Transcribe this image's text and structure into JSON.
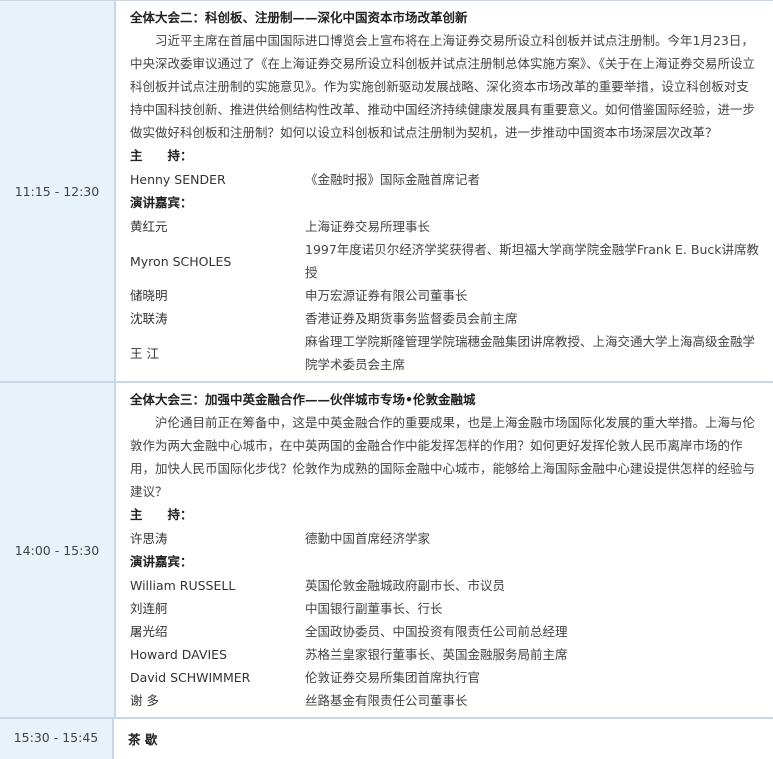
{
  "sessions": [
    {
      "time": "11:15 - 12:30",
      "title": "全体大会二：科创板、注册制——深化中国资本市场改革创新",
      "description": "习近平主席在首届中国国际进口博览会上宣布将在上海证券交易所设立科创板并试点注册制。今年1月23日，中央深改委审议通过了《在上海证券交易所设立科创板并试点注册制总体实施方案》、《关于在上海证券交易所设立科创板并试点注册制的实施意见》。作为实施创新驱动发展战略、深化资本市场改革的重要举措，设立科创板对支持中国科技创新、推进供给侧结构性改革、推动中国经济持续健康发展具有重要意义。如何借鉴国际经验，进一步做实做好科创板和注册制？如何以设立科创板和试点注册制为契机，进一步推动中国资本市场深层次改革？",
      "host_label": "主　　持：",
      "hosts": [
        {
          "name": "Henny SENDER",
          "title": "《金融时报》国际金融首席记者"
        }
      ],
      "speakers_label": "演讲嘉宾：",
      "speakers": [
        {
          "name": "黄红元",
          "title": "上海证券交易所理事长"
        },
        {
          "name": "Myron SCHOLES",
          "title": "1997年度诺贝尔经济学奖获得者、斯坦福大学商学院金融学Frank E. Buck讲席教授"
        },
        {
          "name": "储晓明",
          "title": "申万宏源证券有限公司董事长"
        },
        {
          "name": "沈联涛",
          "title": "香港证券及期货事务监督委员会前主席"
        },
        {
          "name": "王 江",
          "title": "麻省理工学院斯隆管理学院瑞穗金融集团讲席教授、上海交通大学上海高级金融学院学术委员会主席"
        }
      ]
    },
    {
      "time": "14:00 - 15:30",
      "title": "全体大会三：加强中英金融合作——伙伴城市专场•伦敦金融城",
      "description": "沪伦通目前正在筹备中，这是中英金融合作的重要成果，也是上海金融市场国际化发展的重大举措。上海与伦敦作为两大金融中心城市，在中英两国的金融合作中能发挥怎样的作用？如何更好发挥伦敦人民币离岸市场的作用，加快人民币国际化步伐？伦敦作为成熟的国际金融中心城市，能够给上海国际金融中心建设提供怎样的经验与建议？",
      "host_label": "主　　持：",
      "hosts": [
        {
          "name": "许思涛",
          "title": "德勤中国首席经济学家"
        }
      ],
      "speakers_label": "演讲嘉宾：",
      "speakers": [
        {
          "name": "William RUSSELL",
          "title": "英国伦敦金融城政府副市长、市议员"
        },
        {
          "name": "刘连舸",
          "title": "中国银行副董事长、行长"
        },
        {
          "name": "屠光绍",
          "title": "全国政协委员、中国投资有限责任公司前总经理"
        },
        {
          "name": "Howard DAVIES",
          "title": "苏格兰皇家银行董事长、英国金融服务局前主席"
        },
        {
          "name": "David SCHWIMMER",
          "title": "伦敦证券交易所集团首席执行官"
        },
        {
          "name": "谢 多",
          "title": "丝路基金有限责任公司董事长"
        }
      ]
    },
    {
      "time": "15:30 - 15:45",
      "title": "茶 歇"
    }
  ]
}
